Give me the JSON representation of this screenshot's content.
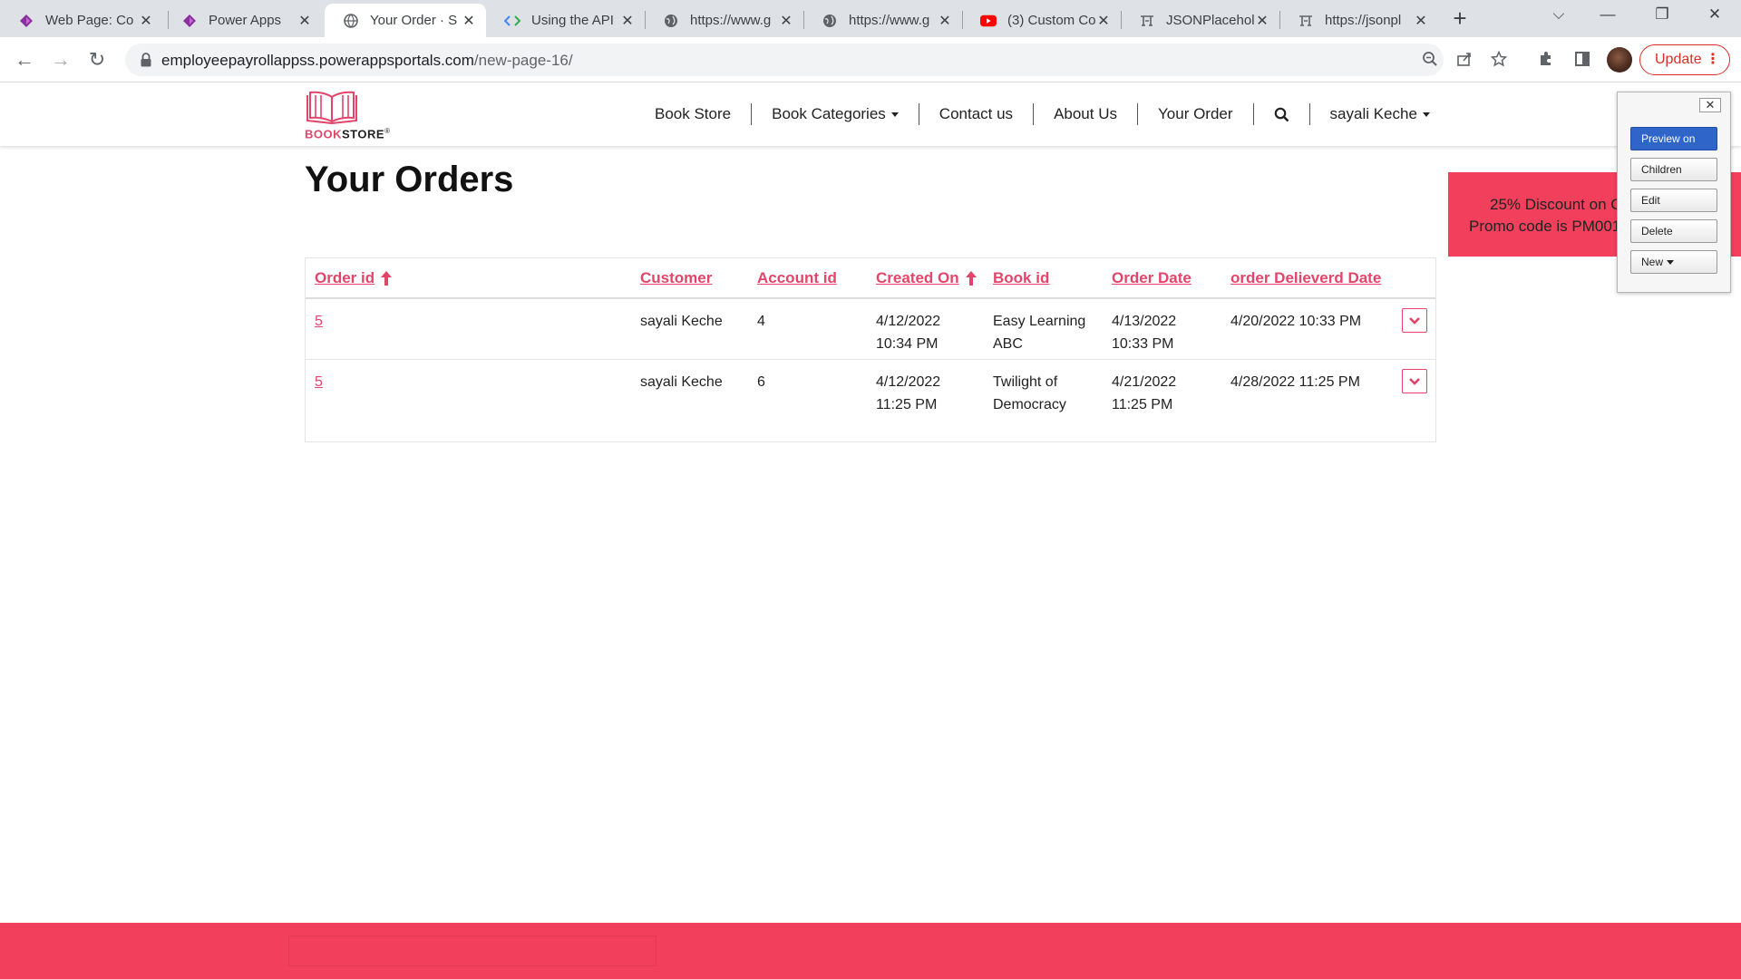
{
  "browser": {
    "tabs": [
      {
        "title": "Web Page: Co",
        "icon": "power-apps-icon"
      },
      {
        "title": "Power Apps",
        "icon": "power-apps-icon"
      },
      {
        "title": "Your Order · S",
        "icon": "globe-icon"
      },
      {
        "title": "Using the API",
        "icon": "code-icon"
      },
      {
        "title": "https://www.g",
        "icon": "globe-icon"
      },
      {
        "title": "https://www.g",
        "icon": "globe-icon"
      },
      {
        "title": "(3) Custom Co",
        "icon": "youtube-icon"
      },
      {
        "title": "JSONPlacehol",
        "icon": "jsonplaceholder-icon"
      },
      {
        "title": "https://jsonpl",
        "icon": "jsonplaceholder-icon"
      }
    ],
    "url_host": "employeepayrollappss.powerappsportals.com",
    "url_path": "/new-page-16/",
    "update_label": "Update"
  },
  "site": {
    "logo_text_highlight": "BOOK",
    "logo_text_rest": "STORE",
    "logo_mark": "®",
    "nav": {
      "book_store": "Book Store",
      "book_categories": "Book Categories",
      "contact": "Contact us",
      "about": "About Us",
      "your_order": "Your Order",
      "user": "sayali Keche"
    }
  },
  "page": {
    "title": "Your Orders",
    "columns": {
      "order_id": "Order id",
      "customer": "Customer",
      "account_id": "Account id",
      "created_on": "Created On",
      "book_id": "Book id",
      "order_date": "Order Date",
      "delivered_date": "order Delieverd Date"
    },
    "rows": [
      {
        "order_id": "5",
        "customer": "sayali Keche",
        "account_id": "4",
        "created_on_date": "4/12/2022",
        "created_on_time": "10:34 PM",
        "book_line1": "Easy Learning",
        "book_line2": "ABC",
        "order_date_date": "4/13/2022",
        "order_date_time": "10:33 PM",
        "delivered": "4/20/2022 10:33 PM"
      },
      {
        "order_id": "5",
        "customer": "sayali Keche",
        "account_id": "6",
        "created_on_date": "4/12/2022",
        "created_on_time": "11:25 PM",
        "book_line1": "Twilight of",
        "book_line2": "Democracy",
        "order_date_date": "4/21/2022",
        "order_date_time": "11:25 PM",
        "delivered": "4/28/2022 11:25 PM"
      }
    ]
  },
  "promo": {
    "line1": "25% Discount on C",
    "line2": "Promo code is  PM001"
  },
  "editor": {
    "close": "✕",
    "preview": "Preview on",
    "children": "Children",
    "edit": "Edit",
    "delete": "Delete",
    "new": "New"
  },
  "colors": {
    "accent": "#e2456a",
    "footer": "#f2405c",
    "preview_button": "#2f64c8"
  }
}
